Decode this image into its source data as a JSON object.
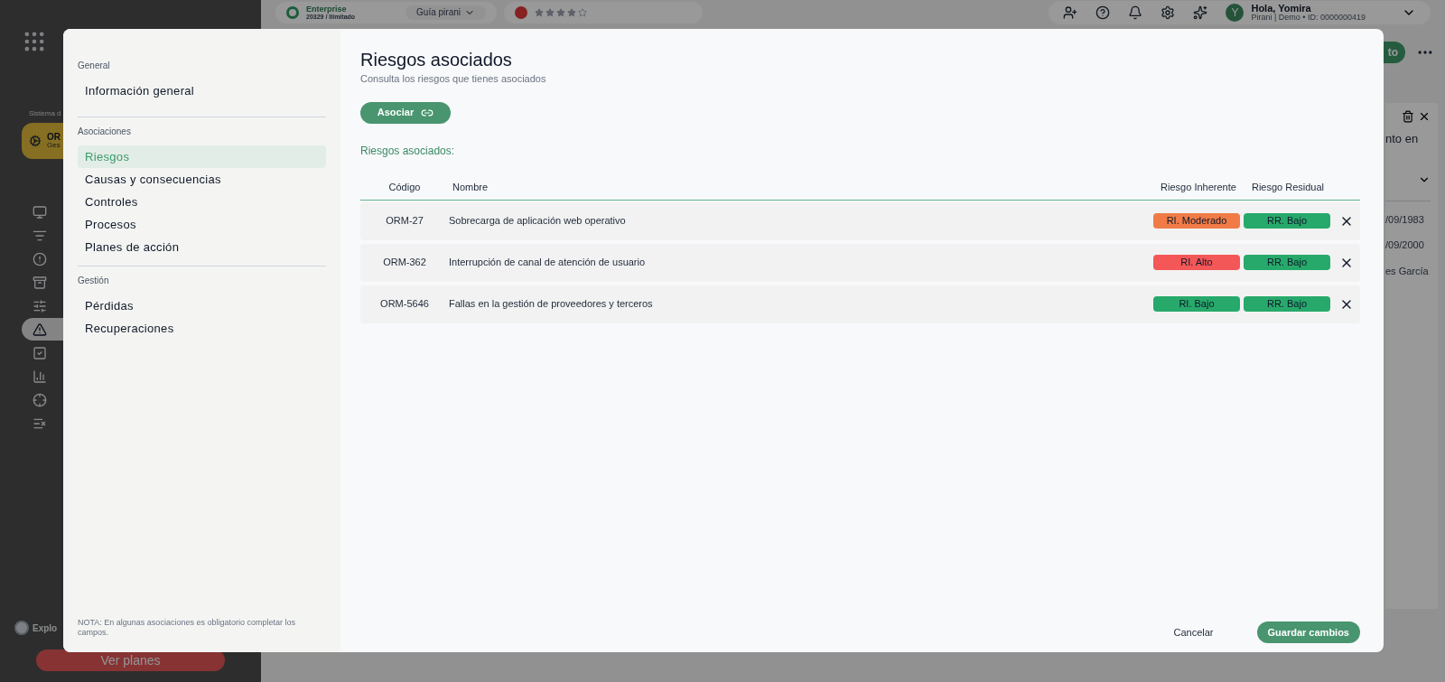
{
  "app": {
    "plan": {
      "name": "Enterprise",
      "detail": "20329 / Ilimitado"
    },
    "guide": "Guía pirani",
    "rating": {
      "stars": 4
    },
    "user": {
      "initial": "Y",
      "greeting": "Hola, Yomira",
      "detail": "Pirani | Demo • ID: 0000000419"
    },
    "sidebar": {
      "system_label": "Sistema d",
      "module": {
        "title": "OR",
        "subtitle": "Ges"
      },
      "items": [
        {
          "selected": false
        },
        {
          "selected": false
        },
        {
          "selected": false
        },
        {
          "selected": false
        },
        {
          "selected": false
        },
        {
          "selected": true
        },
        {
          "selected": false
        },
        {
          "selected": false
        },
        {
          "selected": false
        },
        {
          "selected": false
        }
      ],
      "explore": "Explo",
      "plans_button": "Ver planes"
    },
    "header_button": "to",
    "side_panel": {
      "line": "nto en",
      "values": [
        "/09/1983",
        "/09/2000",
        "es García"
      ]
    }
  },
  "modal": {
    "nav": {
      "sections": [
        {
          "title": "General",
          "items": [
            {
              "label": "Información general",
              "selected": false
            }
          ]
        },
        {
          "title": "Asociaciones",
          "items": [
            {
              "label": "Riesgos",
              "selected": true
            },
            {
              "label": "Causas y consecuencias",
              "selected": false
            },
            {
              "label": "Controles",
              "selected": false
            },
            {
              "label": "Procesos",
              "selected": false
            },
            {
              "label": "Planes de acción",
              "selected": false
            }
          ]
        },
        {
          "title": "Gestión",
          "items": [
            {
              "label": "Pérdidas",
              "selected": false
            },
            {
              "label": "Recuperaciones",
              "selected": false
            }
          ]
        }
      ],
      "note": "NOTA: En algunas asociaciones es obligatorio completar los campos."
    },
    "title": "Riesgos asociados",
    "subtitle": "Consulta los riesgos que tienes asociados",
    "associate_button": "Asociar",
    "section_title": "Riesgos asociados:",
    "table": {
      "columns": [
        "Código",
        "Nombre",
        "Riesgo Inherente",
        "Riesgo Residual"
      ],
      "rows": [
        {
          "code": "ORM-27",
          "name": "Sobrecarga de aplicación web operativo",
          "inherent": {
            "label": "RI. Moderado",
            "color": "#f07b47"
          },
          "residual": {
            "label": "RR. Bajo",
            "color": "#27a96b"
          }
        },
        {
          "code": "ORM-362",
          "name": "Interrupción de canal de atención de usuario",
          "inherent": {
            "label": "RI. Alto",
            "color": "#f45757"
          },
          "residual": {
            "label": "RR. Bajo",
            "color": "#27a96b"
          }
        },
        {
          "code": "ORM-5646",
          "name": "Fallas en la gestión de proveedores y terceros",
          "inherent": {
            "label": "RI. Bajo",
            "color": "#27a96b"
          },
          "residual": {
            "label": "RR. Bajo",
            "color": "#27a96b"
          }
        }
      ]
    },
    "cancel": "Cancelar",
    "save": "Guardar cambios"
  }
}
